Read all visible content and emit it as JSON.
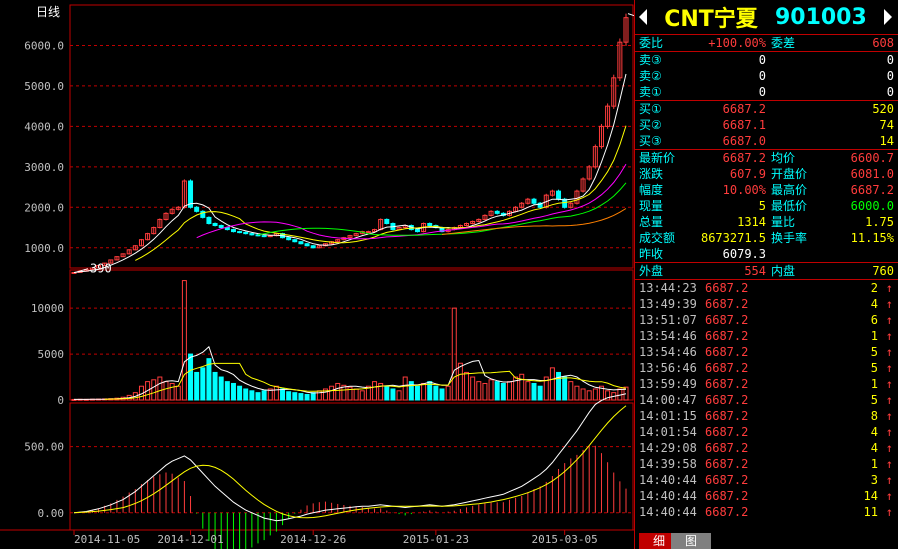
{
  "chart": {
    "period_label": "日线",
    "price_ticks": [
      "6000.0",
      "5000.0",
      "4000.0",
      "3000.0",
      "2000.0",
      "1000.0"
    ],
    "price_tick_values": [
      6000,
      5000,
      4000,
      3000,
      2000,
      1000
    ],
    "price_range": [
      500,
      7000
    ],
    "high_label": "6687.2",
    "low_label": "390",
    "volume_ticks": [
      "10000",
      "5000",
      "0"
    ],
    "volume_tick_values": [
      10000,
      5000,
      0
    ],
    "volume_range": [
      0,
      13500
    ],
    "macd_ticks": [
      "500.00",
      "0.00"
    ],
    "macd_tick_values": [
      500,
      0
    ],
    "macd_range": [
      -100,
      800
    ],
    "date_labels": [
      "2014-11-05",
      "2014-12-01",
      "2014-12-26",
      "2015-01-23",
      "2015-03-05"
    ],
    "date_label_index": [
      0,
      19,
      39,
      59,
      80
    ]
  },
  "chart_data": [
    {
      "type": "candlestick",
      "x": [
        "2014-11-05",
        "2014-12-01",
        "2014-12-26",
        "2015-01-23",
        "2015-03-05"
      ],
      "close": [
        390,
        420,
        460,
        500,
        560,
        620,
        700,
        780,
        850,
        950,
        1050,
        1200,
        1350,
        1500,
        1700,
        1850,
        1950,
        2000,
        2650,
        2000,
        1900,
        1750,
        1600,
        1550,
        1500,
        1450,
        1400,
        1380,
        1350,
        1320,
        1300,
        1280,
        1300,
        1350,
        1250,
        1200,
        1150,
        1100,
        1050,
        1000,
        1050,
        1100,
        1150,
        1200,
        1250,
        1300,
        1350,
        1400,
        1400,
        1450,
        1700,
        1600,
        1450,
        1500,
        1550,
        1450,
        1400,
        1600,
        1550,
        1500,
        1400,
        1450,
        1500,
        1550,
        1600,
        1650,
        1700,
        1800,
        1900,
        1850,
        1800,
        1900,
        2000,
        2100,
        2200,
        2100,
        2000,
        2300,
        2400,
        2200,
        2000,
        2100,
        2400,
        2700,
        3000,
        3500,
        4000,
        4500,
        5200,
        6081,
        6687.2
      ],
      "ylim": [
        500,
        7000
      ]
    },
    {
      "type": "bar",
      "name": "volume",
      "values": [
        60,
        80,
        70,
        90,
        100,
        120,
        150,
        200,
        300,
        500,
        800,
        1500,
        2000,
        2200,
        2500,
        2000,
        1800,
        1500,
        13000,
        5000,
        3000,
        3500,
        4500,
        3000,
        2500,
        2000,
        1800,
        1500,
        1200,
        1000,
        800,
        1000,
        1200,
        1500,
        1200,
        900,
        800,
        700,
        600,
        800,
        1000,
        1200,
        1500,
        1800,
        1600,
        1400,
        1200,
        1000,
        1500,
        2000,
        1800,
        1500,
        1200,
        1000,
        2500,
        2000,
        1500,
        1800,
        2000,
        1500,
        1200,
        1500,
        10000,
        4000,
        3000,
        2500,
        2000,
        1800,
        2200,
        2000,
        1800,
        2000,
        2500,
        2800,
        2000,
        1800,
        1500,
        2500,
        3500,
        3000,
        2500,
        2000,
        1500,
        1200,
        1000,
        1200,
        1500,
        1000,
        800,
        1200,
        1400
      ],
      "ylim": [
        0,
        13500
      ]
    },
    {
      "type": "line",
      "name": "macd",
      "values": [
        0,
        5,
        10,
        20,
        30,
        45,
        60,
        80,
        100,
        130,
        160,
        200,
        240,
        280,
        320,
        360,
        390,
        410,
        430,
        400,
        350,
        300,
        250,
        200,
        160,
        120,
        80,
        50,
        20,
        0,
        -20,
        -40,
        -50,
        -60,
        -55,
        -45,
        -35,
        -25,
        -10,
        0,
        10,
        20,
        25,
        30,
        35,
        40,
        45,
        50,
        50,
        55,
        60,
        55,
        50,
        45,
        40,
        45,
        50,
        55,
        60,
        55,
        50,
        55,
        60,
        70,
        80,
        90,
        100,
        110,
        120,
        130,
        140,
        160,
        180,
        200,
        230,
        260,
        290,
        330,
        380,
        440,
        500,
        560,
        620,
        690,
        760,
        820,
        850,
        870,
        880,
        890,
        900
      ],
      "ylim": [
        -100,
        800
      ]
    }
  ],
  "header": {
    "name": "CNT宁夏",
    "code": "901003"
  },
  "ratio": {
    "label1": "委比",
    "value1": "+100.00%",
    "label2": "委差",
    "value2": "608"
  },
  "sell": [
    {
      "label": "卖③",
      "price": "0",
      "vol": "0"
    },
    {
      "label": "卖②",
      "price": "0",
      "vol": "0"
    },
    {
      "label": "卖①",
      "price": "0",
      "vol": "0"
    }
  ],
  "buy": [
    {
      "label": "买①",
      "price": "6687.2",
      "vol": "520"
    },
    {
      "label": "买②",
      "price": "6687.1",
      "vol": "74"
    },
    {
      "label": "买③",
      "price": "6687.0",
      "vol": "14"
    }
  ],
  "stats": [
    {
      "l1": "最新价",
      "v1": "6687.2",
      "c1": "red",
      "l2": "均价",
      "v2": "6600.7",
      "c2": "red"
    },
    {
      "l1": "涨跌",
      "v1": "607.9",
      "c1": "red",
      "l2": "开盘价",
      "v2": "6081.0",
      "c2": "red"
    },
    {
      "l1": "幅度",
      "v1": "10.00%",
      "c1": "red",
      "l2": "最高价",
      "v2": "6687.2",
      "c2": "red"
    },
    {
      "l1": "现量",
      "v1": "5",
      "c1": "yel",
      "l2": "最低价",
      "v2": "6000.0",
      "c2": "grn"
    },
    {
      "l1": "总量",
      "v1": "1314",
      "c1": "yel",
      "l2": "量比",
      "v2": "1.75",
      "c2": "yel"
    },
    {
      "l1": "成交额",
      "v1": "8673271.5",
      "c1": "yel",
      "l2": "换手率",
      "v2": "11.15%",
      "c2": "yel"
    },
    {
      "l1": "昨收",
      "v1": "6079.3",
      "c1": "wht",
      "l2": "",
      "v2": "",
      "c2": "wht"
    }
  ],
  "outer": {
    "l1": "外盘",
    "v1": "554",
    "l2": "内盘",
    "v2": "760"
  },
  "ticks": [
    {
      "time": "13:44:23",
      "price": "6687.2",
      "qty": "2",
      "dir": "↑"
    },
    {
      "time": "13:49:39",
      "price": "6687.2",
      "qty": "4",
      "dir": "↑"
    },
    {
      "time": "13:51:07",
      "price": "6687.2",
      "qty": "6",
      "dir": "↑"
    },
    {
      "time": "13:54:46",
      "price": "6687.2",
      "qty": "1",
      "dir": "↑"
    },
    {
      "time": "13:54:46",
      "price": "6687.2",
      "qty": "5",
      "dir": "↑"
    },
    {
      "time": "13:56:46",
      "price": "6687.2",
      "qty": "5",
      "dir": "↑"
    },
    {
      "time": "13:59:49",
      "price": "6687.2",
      "qty": "1",
      "dir": "↑"
    },
    {
      "time": "14:00:47",
      "price": "6687.2",
      "qty": "5",
      "dir": "↑"
    },
    {
      "time": "14:01:15",
      "price": "6687.2",
      "qty": "8",
      "dir": "↑"
    },
    {
      "time": "14:01:54",
      "price": "6687.2",
      "qty": "4",
      "dir": "↑"
    },
    {
      "time": "14:29:08",
      "price": "6687.2",
      "qty": "4",
      "dir": "↑"
    },
    {
      "time": "14:39:58",
      "price": "6687.2",
      "qty": "1",
      "dir": "↑"
    },
    {
      "time": "14:40:44",
      "price": "6687.2",
      "qty": "3",
      "dir": "↑"
    },
    {
      "time": "14:40:44",
      "price": "6687.2",
      "qty": "14",
      "dir": "↑"
    },
    {
      "time": "14:40:44",
      "price": "6687.2",
      "qty": "11",
      "dir": "↑"
    }
  ],
  "tabs": {
    "detail": "细",
    "chart": "图"
  },
  "colors": {
    "up": "#ff3c3c",
    "down": "#00ffff",
    "grid": "#c00000",
    "ma1": "#ffffff",
    "ma2": "#ffff00",
    "ma3": "#ff00ff",
    "ma4": "#00ff00",
    "ma5": "#ff8000"
  }
}
